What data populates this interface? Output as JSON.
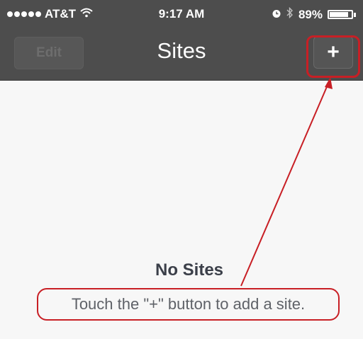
{
  "status_bar": {
    "carrier": "AT&T",
    "time": "9:17 AM",
    "battery": "89%",
    "battery_level": 0.89,
    "icons": [
      "signal-dots-icon",
      "wifi-icon",
      "alarm-icon",
      "bluetooth-icon",
      "battery-icon"
    ]
  },
  "nav": {
    "edit_label": "Edit",
    "title": "Sites",
    "add_label": "+"
  },
  "empty_state": {
    "title": "No Sites",
    "message": "Touch the \"+\" button to add a site."
  },
  "colors": {
    "bar": "#4d4d4d",
    "annotation": "#c81f25",
    "background": "#f7f7f7"
  }
}
